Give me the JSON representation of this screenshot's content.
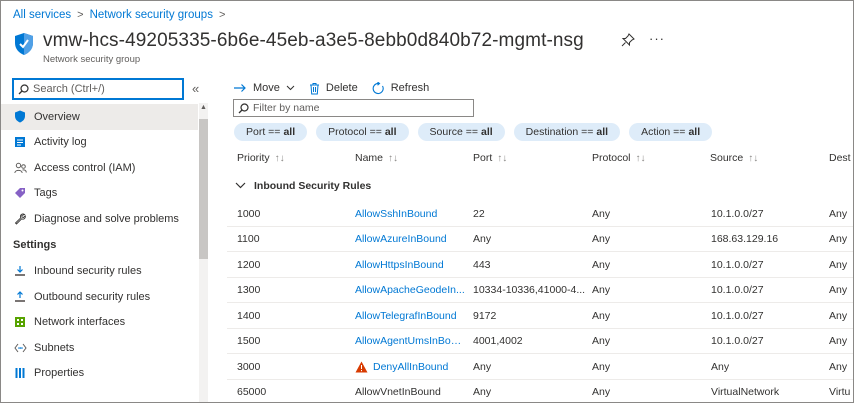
{
  "breadcrumb": {
    "items": [
      "All services",
      "Network security groups"
    ],
    "separator": ">"
  },
  "header": {
    "title": "vmw-hcs-49205335-6b6e-45eb-a3e5-8ebb0d840b72-mgmt-nsg",
    "subtitle": "Network security group",
    "more_label": "···"
  },
  "sidebar": {
    "search_placeholder": "Search (Ctrl+/)",
    "collapse_label": "«",
    "items": [
      {
        "label": "Overview",
        "icon": "shield-icon",
        "active": true
      },
      {
        "label": "Activity log",
        "icon": "activity-log-icon"
      },
      {
        "label": "Access control (IAM)",
        "icon": "people-icon"
      },
      {
        "label": "Tags",
        "icon": "tag-icon"
      },
      {
        "label": "Diagnose and solve problems",
        "icon": "wrench-icon"
      }
    ],
    "settings_label": "Settings",
    "settings_items": [
      {
        "label": "Inbound security rules",
        "icon": "inbound-icon"
      },
      {
        "label": "Outbound security rules",
        "icon": "outbound-icon"
      },
      {
        "label": "Network interfaces",
        "icon": "network-interface-icon"
      },
      {
        "label": "Subnets",
        "icon": "subnet-icon"
      },
      {
        "label": "Properties",
        "icon": "properties-icon"
      }
    ]
  },
  "toolbar": {
    "move_label": "Move",
    "delete_label": "Delete",
    "refresh_label": "Refresh"
  },
  "filter": {
    "placeholder": "Filter by name"
  },
  "pills": [
    {
      "key": "Port ==",
      "value": "all"
    },
    {
      "key": "Protocol ==",
      "value": "all"
    },
    {
      "key": "Source ==",
      "value": "all"
    },
    {
      "key": "Destination ==",
      "value": "all"
    },
    {
      "key": "Action ==",
      "value": "all"
    }
  ],
  "table": {
    "columns": [
      "Priority",
      "Name",
      "Port",
      "Protocol",
      "Source",
      "Dest"
    ],
    "sort_glyph": "↑↓",
    "group_label": "Inbound Security Rules",
    "rows": [
      {
        "priority": "1000",
        "name": "AllowSshInBound",
        "port": "22",
        "protocol": "Any",
        "source": "10.1.0.0/27",
        "dest": "Any",
        "link": true
      },
      {
        "priority": "1100",
        "name": "AllowAzureInBound",
        "port": "Any",
        "protocol": "Any",
        "source": "168.63.129.16",
        "dest": "Any",
        "link": true
      },
      {
        "priority": "1200",
        "name": "AllowHttpsInBound",
        "port": "443",
        "protocol": "Any",
        "source": "10.1.0.0/27",
        "dest": "Any",
        "link": true
      },
      {
        "priority": "1300",
        "name": "AllowApacheGeodeIn...",
        "port": "10334-10336,41000-4...",
        "protocol": "Any",
        "source": "10.1.0.0/27",
        "dest": "Any",
        "link": true
      },
      {
        "priority": "1400",
        "name": "AllowTelegrafInBound",
        "port": "9172",
        "protocol": "Any",
        "source": "10.1.0.0/27",
        "dest": "Any",
        "link": true
      },
      {
        "priority": "1500",
        "name": "AllowAgentUmsInBound",
        "port": "4001,4002",
        "protocol": "Any",
        "source": "10.1.0.0/27",
        "dest": "Any",
        "link": true
      },
      {
        "priority": "3000",
        "name": "DenyAllInBound",
        "port": "Any",
        "protocol": "Any",
        "source": "Any",
        "dest": "Any",
        "link": true,
        "warning": true
      },
      {
        "priority": "65000",
        "name": "AllowVnetInBound",
        "port": "Any",
        "protocol": "Any",
        "source": "VirtualNetwork",
        "dest": "Virtu",
        "link": false
      }
    ]
  },
  "colors": {
    "link": "#0078d4",
    "pill_bg": "#deecf9",
    "active_nav": "#edebe9",
    "warning": "#d83b01"
  }
}
